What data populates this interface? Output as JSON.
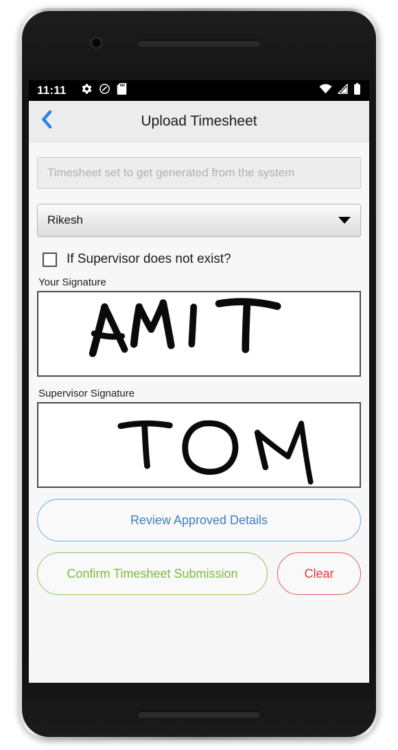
{
  "status_bar": {
    "time": "11:11",
    "left_icons": [
      "gear-icon",
      "do-not-disturb-icon",
      "sd-card-icon"
    ],
    "right_icons": [
      "wifi-icon",
      "cellular-signal-icon",
      "battery-icon"
    ]
  },
  "app_bar": {
    "back_icon": "chevron-left-icon",
    "title": "Upload Timesheet"
  },
  "form": {
    "timesheet_field": {
      "placeholder": "Timesheet set to get generated from the system",
      "value": "",
      "disabled": true
    },
    "supervisor_select": {
      "value": "Rikesh",
      "caret_icon": "chevron-down-icon"
    },
    "supervisor_checkbox": {
      "label": "If Supervisor does not exist?",
      "checked": false
    },
    "your_signature": {
      "label": "Your Signature",
      "drawn_text": "AMIT"
    },
    "supervisor_signature": {
      "label": "Supervisor Signature",
      "drawn_text": "TOM"
    }
  },
  "buttons": {
    "review": "Review Approved Details",
    "confirm": "Confirm Timesheet Submission",
    "clear": "Clear"
  },
  "nav_bar": {
    "back": "back-triangle-icon",
    "home": "home-circle-icon",
    "recents": "recents-square-icon"
  },
  "colors": {
    "accent_blue": "#2b84e8",
    "review_blue": "#3f7fbf",
    "confirm_green": "#7cbb3f",
    "clear_red": "#e03a3a",
    "status_bar_bg": "#000000",
    "app_bar_bg": "#ececec",
    "content_bg": "#f7f7f7"
  }
}
